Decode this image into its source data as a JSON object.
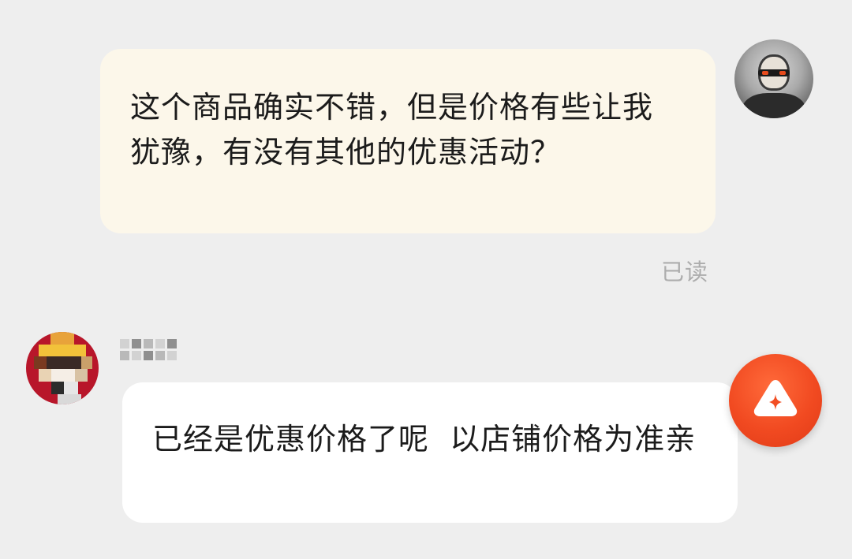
{
  "messages": [
    {
      "direction": "outgoing",
      "text": "这个商品确实不错，但是价格有些让我犹豫，有没有其他的优惠活动？",
      "status": "已读",
      "avatar_icon": "user-avatar"
    },
    {
      "direction": "incoming",
      "sender_name": "",
      "text": "已经是优惠价格了呢  以店铺价格为准亲",
      "avatar_icon": "shop-avatar"
    }
  ],
  "floating_button": {
    "icon": "ai-assistant-sparkle-icon",
    "color": "#f24d22"
  },
  "colors": {
    "background": "#eeeeee",
    "outgoing_bubble": "#fcf7ea",
    "incoming_bubble": "#ffffff",
    "status_text": "#adadad"
  }
}
